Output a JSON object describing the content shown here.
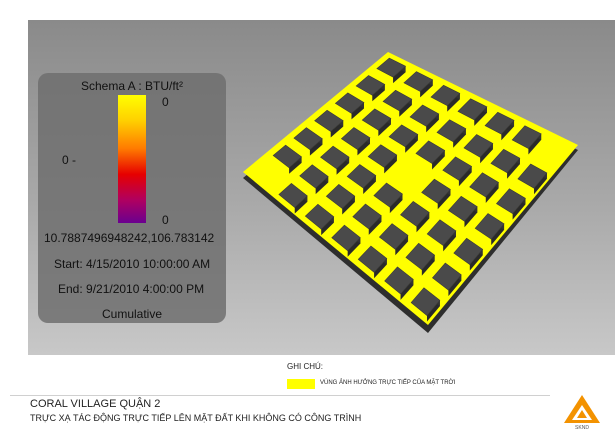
{
  "legend": {
    "title": "Schema A : BTU/ft²",
    "scale_top": "0",
    "scale_bottom": "0",
    "mid_label": "0 -",
    "coordinates": "10.7887496948242,106.783142",
    "start": "Start: 4/15/2010 10:00:00 AM",
    "end": "End: 9/21/2010 4:00:00 PM",
    "mode": "Cumulative"
  },
  "note": {
    "label": "GHI CHÚ:",
    "text": "VÙNG ẢNH HƯỞNG TRỰC TIẾP CỦA MẶT TRỜI"
  },
  "footer": {
    "title": "CORAL VILLAGE QUẬN 2",
    "subtitle": "TRỰC XẠ TÁC ĐỘNG TRỰC TIẾP LÊN MẶT ĐẤT KHI KHÔNG CÓ CÔNG TRÌNH",
    "logo_text": "SKND"
  },
  "colors": {
    "highlight": "#ffff00",
    "building": "#4a4a4a",
    "logo_orange": "#f39200"
  }
}
